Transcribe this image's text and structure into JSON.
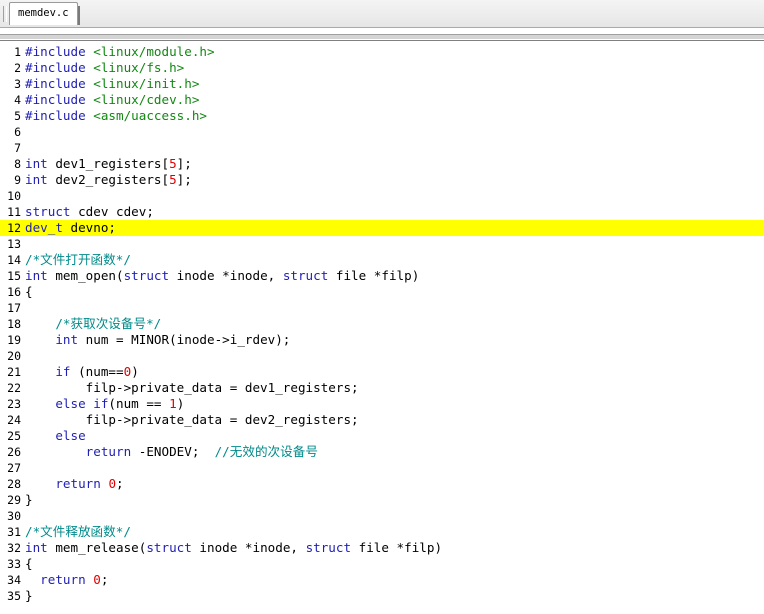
{
  "tabs": [
    {
      "label": "memdev.c",
      "active": true
    }
  ],
  "colors": {
    "keyword": "#1f1fb4",
    "header": "#118811",
    "number": "#e00000",
    "comment": "#008a8a",
    "current_line": "#ffff00"
  },
  "editor": {
    "current_line": 12,
    "lines": [
      {
        "n": "1",
        "tokens": [
          [
            "inc",
            "#include"
          ],
          [
            "",
            " "
          ],
          [
            "hdr",
            "<linux/module.h>"
          ]
        ]
      },
      {
        "n": "2",
        "tokens": [
          [
            "inc",
            "#include"
          ],
          [
            "",
            " "
          ],
          [
            "hdr",
            "<linux/fs.h>"
          ]
        ]
      },
      {
        "n": "3",
        "tokens": [
          [
            "inc",
            "#include"
          ],
          [
            "",
            " "
          ],
          [
            "hdr",
            "<linux/init.h>"
          ]
        ]
      },
      {
        "n": "4",
        "tokens": [
          [
            "inc",
            "#include"
          ],
          [
            "",
            " "
          ],
          [
            "hdr",
            "<linux/cdev.h>"
          ]
        ]
      },
      {
        "n": "5",
        "tokens": [
          [
            "inc",
            "#include"
          ],
          [
            "",
            " "
          ],
          [
            "hdr",
            "<asm/uaccess.h>"
          ]
        ]
      },
      {
        "n": "6",
        "tokens": []
      },
      {
        "n": "7",
        "tokens": []
      },
      {
        "n": "8",
        "tokens": [
          [
            "kw",
            "int"
          ],
          [
            "",
            " dev1_registers["
          ],
          [
            "num",
            "5"
          ],
          [
            "",
            "];"
          ]
        ]
      },
      {
        "n": "9",
        "tokens": [
          [
            "kw",
            "int"
          ],
          [
            "",
            " dev2_registers["
          ],
          [
            "num",
            "5"
          ],
          [
            "",
            "];"
          ]
        ]
      },
      {
        "n": "10",
        "tokens": []
      },
      {
        "n": "11",
        "tokens": [
          [
            "kw",
            "struct"
          ],
          [
            "",
            " cdev cdev;"
          ]
        ]
      },
      {
        "n": "12",
        "tokens": [
          [
            "kw",
            "dev_t"
          ],
          [
            "",
            " devno;"
          ]
        ]
      },
      {
        "n": "13",
        "tokens": []
      },
      {
        "n": "14",
        "tokens": [
          [
            "com",
            "/*"
          ],
          [
            "com cjk",
            "文件打开函数"
          ],
          [
            "com",
            "*/"
          ]
        ]
      },
      {
        "n": "15",
        "tokens": [
          [
            "kw",
            "int"
          ],
          [
            "",
            " mem_open("
          ],
          [
            "kw",
            "struct"
          ],
          [
            "",
            " inode *inode, "
          ],
          [
            "kw",
            "struct"
          ],
          [
            "",
            " file *filp)"
          ]
        ]
      },
      {
        "n": "16",
        "tokens": [
          [
            "",
            "{"
          ]
        ]
      },
      {
        "n": "17",
        "tokens": []
      },
      {
        "n": "18",
        "tokens": [
          [
            "",
            "    "
          ],
          [
            "com",
            "/*"
          ],
          [
            "com cjk",
            "获取次设备号"
          ],
          [
            "com",
            "*/"
          ]
        ]
      },
      {
        "n": "19",
        "tokens": [
          [
            "",
            "    "
          ],
          [
            "kw",
            "int"
          ],
          [
            "",
            " num = MINOR(inode->i_rdev);"
          ]
        ]
      },
      {
        "n": "20",
        "tokens": []
      },
      {
        "n": "21",
        "tokens": [
          [
            "",
            "    "
          ],
          [
            "kw",
            "if"
          ],
          [
            "",
            " (num=="
          ],
          [
            "num",
            "0"
          ],
          [
            "",
            ")"
          ]
        ]
      },
      {
        "n": "22",
        "tokens": [
          [
            "",
            "        filp->private_data = dev1_registers;"
          ]
        ]
      },
      {
        "n": "23",
        "tokens": [
          [
            "",
            "    "
          ],
          [
            "kw",
            "else if"
          ],
          [
            "",
            "(num == "
          ],
          [
            "num",
            "1"
          ],
          [
            "",
            ")"
          ]
        ]
      },
      {
        "n": "24",
        "tokens": [
          [
            "",
            "        filp->private_data = dev2_registers;"
          ]
        ]
      },
      {
        "n": "25",
        "tokens": [
          [
            "",
            "    "
          ],
          [
            "kw",
            "else"
          ]
        ]
      },
      {
        "n": "26",
        "tokens": [
          [
            "",
            "        "
          ],
          [
            "kw",
            "return"
          ],
          [
            "",
            " -ENODEV;  "
          ],
          [
            "com",
            "//"
          ],
          [
            "com cjk",
            "无效的次设备号"
          ]
        ]
      },
      {
        "n": "27",
        "tokens": []
      },
      {
        "n": "28",
        "tokens": [
          [
            "",
            "    "
          ],
          [
            "kw",
            "return"
          ],
          [
            "",
            " "
          ],
          [
            "num",
            "0"
          ],
          [
            "",
            ";"
          ]
        ]
      },
      {
        "n": "29",
        "tokens": [
          [
            "",
            "}"
          ]
        ]
      },
      {
        "n": "30",
        "tokens": []
      },
      {
        "n": "31",
        "tokens": [
          [
            "com",
            "/*"
          ],
          [
            "com cjk",
            "文件释放函数"
          ],
          [
            "com",
            "*/"
          ]
        ]
      },
      {
        "n": "32",
        "tokens": [
          [
            "kw",
            "int"
          ],
          [
            "",
            " mem_release("
          ],
          [
            "kw",
            "struct"
          ],
          [
            "",
            " inode *inode, "
          ],
          [
            "kw",
            "struct"
          ],
          [
            "",
            " file *filp)"
          ]
        ]
      },
      {
        "n": "33",
        "tokens": [
          [
            "",
            "{"
          ]
        ]
      },
      {
        "n": "34",
        "tokens": [
          [
            "",
            "  "
          ],
          [
            "kw",
            "return"
          ],
          [
            "",
            " "
          ],
          [
            "num",
            "0"
          ],
          [
            "",
            ";"
          ]
        ]
      },
      {
        "n": "35",
        "tokens": [
          [
            "",
            "}"
          ]
        ]
      }
    ]
  }
}
